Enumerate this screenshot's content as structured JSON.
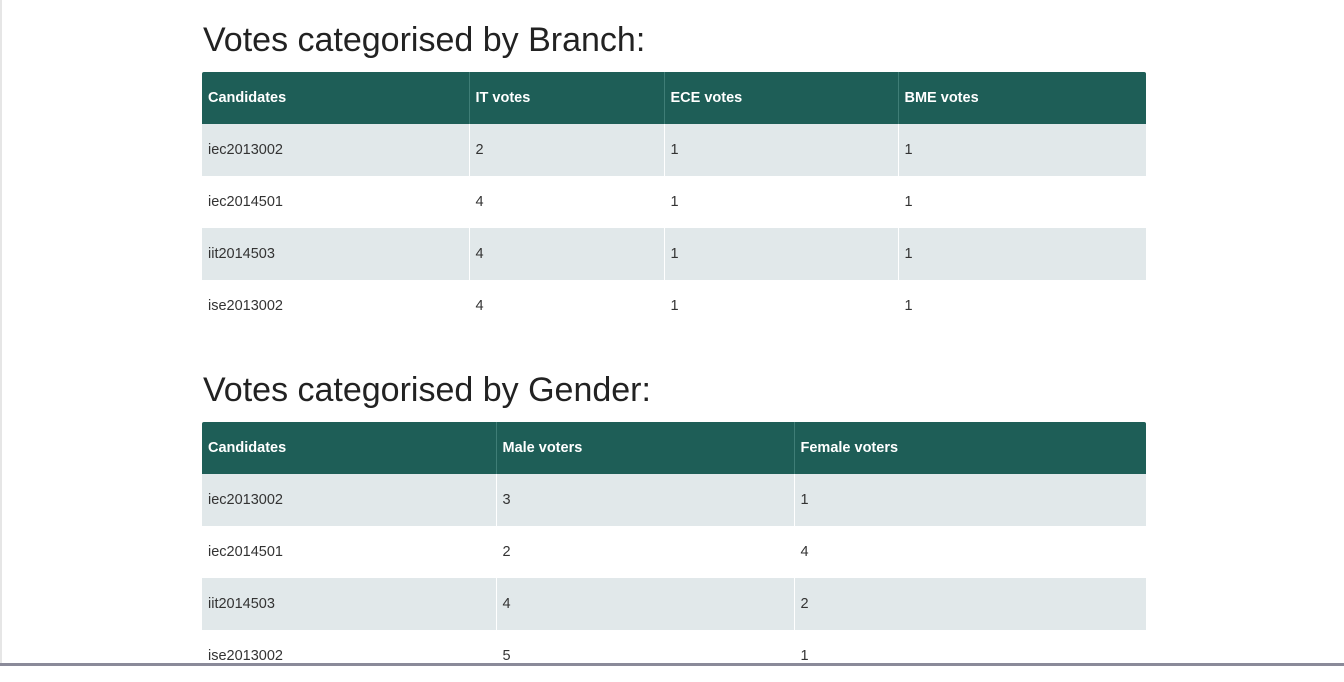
{
  "branch_section": {
    "title": "Votes categorised by Branch:",
    "columns": [
      "Candidates",
      "IT votes",
      "ECE votes",
      "BME votes"
    ],
    "rows": [
      [
        "iec2013002",
        "2",
        "1",
        "1"
      ],
      [
        "iec2014501",
        "4",
        "1",
        "1"
      ],
      [
        "iit2014503",
        "4",
        "1",
        "1"
      ],
      [
        "ise2013002",
        "4",
        "1",
        "1"
      ]
    ]
  },
  "gender_section": {
    "title": "Votes categorised by Gender:",
    "columns": [
      "Candidates",
      "Male voters",
      "Female voters"
    ],
    "rows": [
      [
        "iec2013002",
        "3",
        "1"
      ],
      [
        "iec2014501",
        "2",
        "4"
      ],
      [
        "iit2014503",
        "4",
        "2"
      ],
      [
        "ise2013002",
        "5",
        "1"
      ]
    ]
  },
  "colors": {
    "header_bg": "#1e5e57",
    "stripe_bg": "#e1e8ea"
  }
}
